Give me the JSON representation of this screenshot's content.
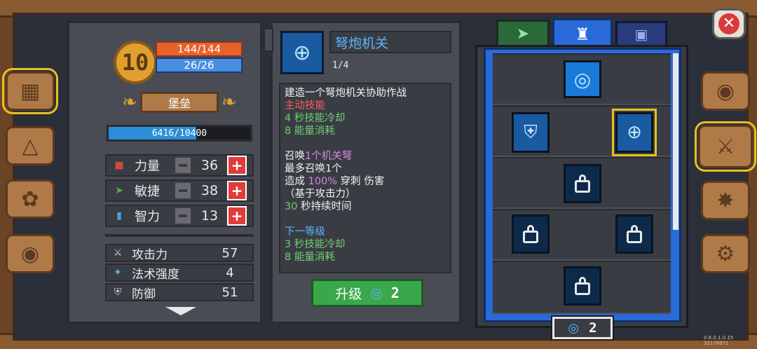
{
  "hero": {
    "level": "10",
    "hp": "144/144",
    "mp": "26/26",
    "class_name": "堡垒",
    "xp": "6416/10400",
    "xp_fraction": 0.617
  },
  "stats": [
    {
      "label": "力量",
      "value": "36",
      "icon": "fist-icon",
      "color": "#d04a3a"
    },
    {
      "label": "敏捷",
      "value": "38",
      "icon": "feather-icon",
      "color": "#5ab04a"
    },
    {
      "label": "智力",
      "value": "13",
      "icon": "book-icon",
      "color": "#4aa0e0"
    }
  ],
  "attributes": [
    {
      "label": "攻击力",
      "value": "57",
      "icon": "sword-icon"
    },
    {
      "label": "法术强度",
      "value": "4",
      "icon": "wand-icon"
    },
    {
      "label": "防御",
      "value": "51",
      "icon": "shield-icon"
    }
  ],
  "skill": {
    "name": "弩炮机关",
    "level": "1/4",
    "lines": [
      {
        "parts": [
          {
            "t": "建造一个弩炮机关协助作战",
            "c": ""
          }
        ]
      },
      {
        "parts": [
          {
            "t": "主动技能",
            "c": "red"
          }
        ]
      },
      {
        "parts": [
          {
            "t": "4 秒技能冷却",
            "c": "green"
          }
        ]
      },
      {
        "parts": [
          {
            "t": "8 能量消耗",
            "c": "green"
          }
        ]
      },
      {
        "parts": [
          {
            "t": "",
            "c": ""
          }
        ]
      },
      {
        "parts": [
          {
            "t": "召唤",
            "c": ""
          },
          {
            "t": "1个机关弩",
            "c": "purple"
          }
        ]
      },
      {
        "parts": [
          {
            "t": "最多召唤1个",
            "c": ""
          }
        ]
      },
      {
        "parts": [
          {
            "t": "造成 ",
            "c": ""
          },
          {
            "t": "100%",
            "c": "purple"
          },
          {
            "t": " 穿刺 伤害",
            "c": ""
          }
        ]
      },
      {
        "parts": [
          {
            "t": "（基于攻击力）",
            "c": ""
          }
        ]
      },
      {
        "parts": [
          {
            "t": "30",
            "c": "green"
          },
          {
            "t": " 秒持续时间",
            "c": ""
          }
        ]
      },
      {
        "parts": [
          {
            "t": "",
            "c": ""
          }
        ]
      },
      {
        "parts": [
          {
            "t": "下一等级",
            "c": "blue"
          }
        ]
      },
      {
        "parts": [
          {
            "t": "3 秒技能冷却",
            "c": "green"
          }
        ]
      },
      {
        "parts": [
          {
            "t": "8 能量消耗",
            "c": "green"
          }
        ]
      }
    ],
    "upgrade_label": "升级",
    "upgrade_cost": "2"
  },
  "skill_points": "2",
  "version": "0.6.0.1.0.15 32176971",
  "colors": {
    "accent_blue": "#2a6ad8",
    "upgrade_green": "#3aa84a",
    "hp_bar": "#e8602a",
    "mp_bar": "#4a8ee0"
  }
}
